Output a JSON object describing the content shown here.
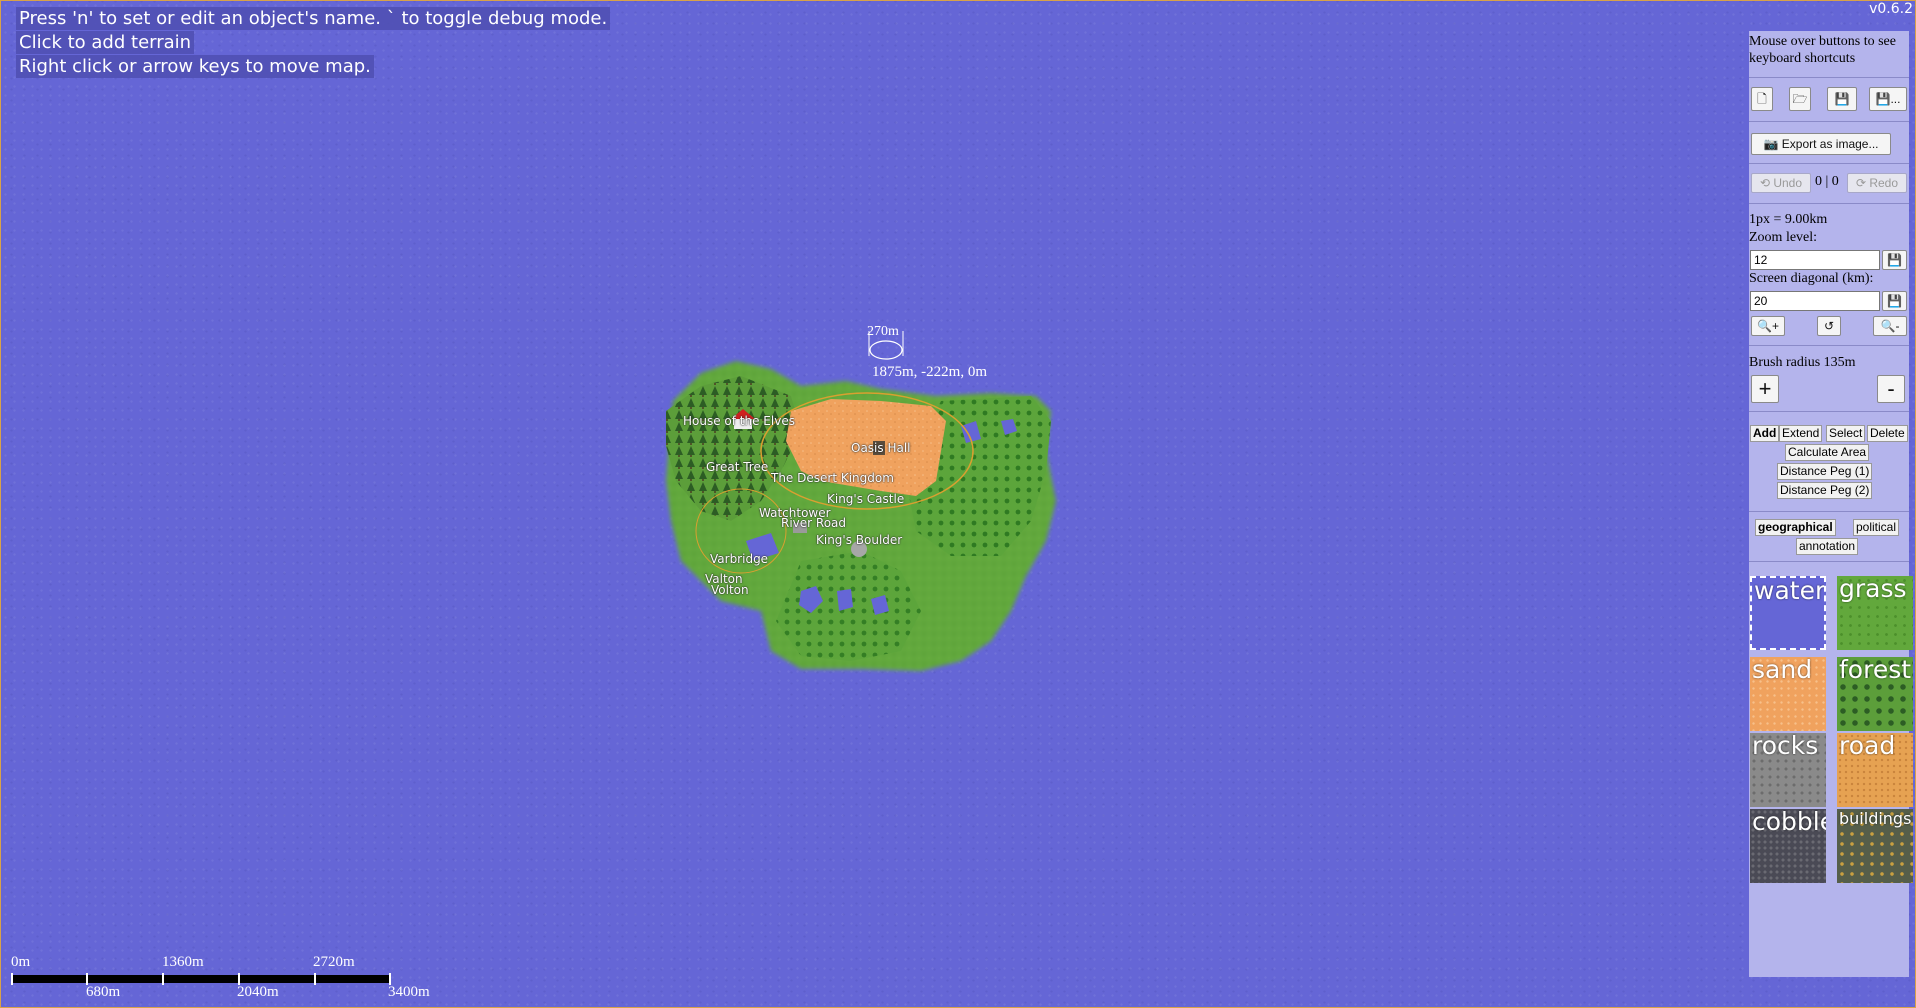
{
  "version": "v0.6.2",
  "help_lines": [
    "Press 'n' to set or edit an object's name. ` to toggle debug mode.",
    "Click to add terrain",
    "Right click or arrow keys to move map."
  ],
  "colors": {
    "water": "#6566d6",
    "grass": "#5fa83a",
    "sand": "#f0a25e",
    "forest": "#2f6b2a",
    "sidebar": "#b4b4ec",
    "selection_outline": "#d9a030"
  },
  "map": {
    "labels": [
      "House of the Elves",
      "Great Tree",
      "Oasis Hall",
      "The Desert Kingdom",
      "King's Castle",
      "Watchtower",
      "River Road",
      "King's Boulder",
      "Varbridge",
      "Valton",
      "Volton"
    ],
    "brush_size_label": "270m",
    "cursor_coords": "1875m, -222m, 0m"
  },
  "scale_bar": {
    "top_labels": [
      "0m",
      "1360m",
      "2720m"
    ],
    "bottom_labels": [
      "680m",
      "2040m",
      "3400m"
    ]
  },
  "sidebar": {
    "hint": "Mouse over buttons to see keyboard shortcuts",
    "file_buttons": [
      {
        "name": "new-map-icon",
        "glyph": "🗋"
      },
      {
        "name": "open-map-icon",
        "glyph": "🗁"
      },
      {
        "name": "save-icon",
        "glyph": "💾"
      },
      {
        "name": "save-as-icon",
        "glyph": "💾..."
      }
    ],
    "export_label": "📷 Export as image...",
    "undo_label": "⟲ Undo",
    "history_counts": "0 | 0",
    "redo_label": "⟳ Redo",
    "scale_text": "1px = 9.00km",
    "zoom_label": "Zoom level:",
    "zoom_value": "12",
    "diagonal_label": "Screen diagonal (km):",
    "diagonal_value": "20",
    "zoom_in_glyph": "🔍+",
    "reset_glyph": "↺",
    "zoom_out_glyph": "🔍-",
    "save_small_glyph": "💾",
    "brush_label": "Brush radius 135m",
    "brush_plus": "+",
    "brush_minus": "-",
    "tools": [
      "Add",
      "Extend",
      "Select",
      "Delete"
    ],
    "calc_area": "Calculate Area",
    "peg1": "Distance Peg (1)",
    "peg2": "Distance Peg (2)",
    "layers": [
      "geographical",
      "political",
      "annotation"
    ],
    "terrains": [
      "water",
      "grass",
      "sand",
      "forest",
      "rocks",
      "road",
      "cobble",
      "buildings"
    ]
  }
}
